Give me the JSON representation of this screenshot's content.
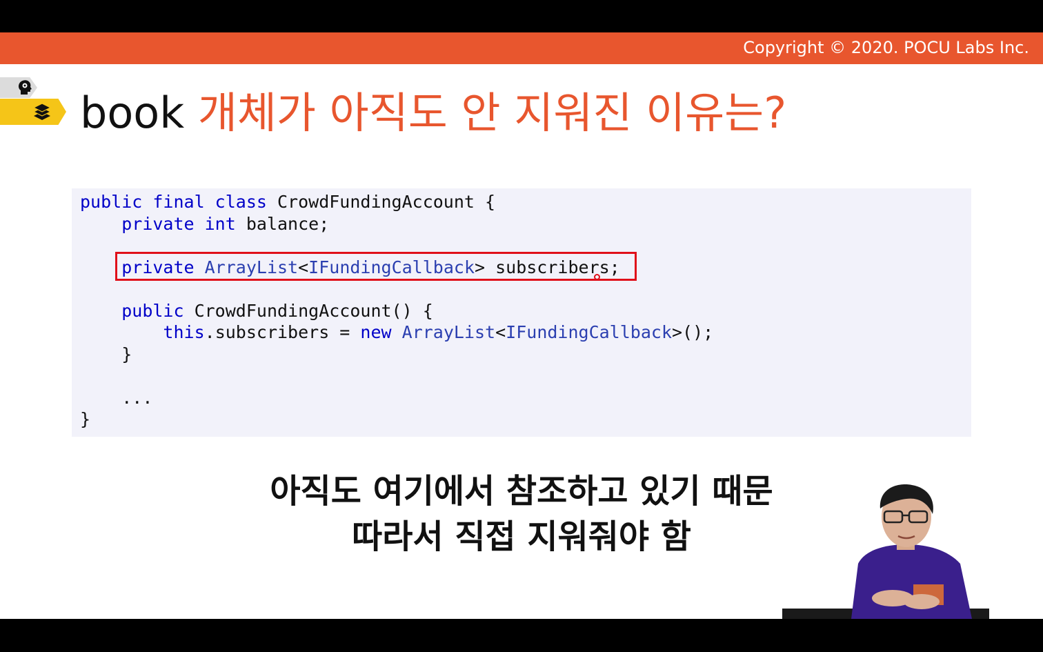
{
  "header": {
    "copyright": "Copyright © 2020. POCU Labs Inc."
  },
  "sidebar_tags": {
    "top_icon": "head-brain-icon",
    "bottom_icon": "stacked-books-icon",
    "colors": {
      "top": "#dcdcdc",
      "bottom": "#f5c518"
    }
  },
  "title": {
    "keyword": "book",
    "text": "개체가 아직도 안 지워진 이유는?"
  },
  "code": {
    "line1": {
      "kw": "public final class",
      "rest": " CrowdFundingAccount {"
    },
    "line2": {
      "kw": "private int",
      "rest": " balance;"
    },
    "line3": {
      "kw": "private",
      "type": "ArrayList",
      "lt": "<",
      "type2": "IFundingCallback",
      "rest": "> subscribers;"
    },
    "line4": {
      "kw": "public",
      "rest": " CrowdFundingAccount() {"
    },
    "line5": {
      "kw": "this",
      "mid": ".subscribers = ",
      "kw2": "new",
      "type": "ArrayList",
      "lt": "<",
      "type2": "IFundingCallback",
      "rest": ">();"
    },
    "line6": "}",
    "line7": "...",
    "line8": "}"
  },
  "subtitles": {
    "line1": "아직도 여기에서 참조하고 있기 때문",
    "line2": "따라서 직접 지워줘야 함"
  },
  "colors": {
    "accent": "#e8562e",
    "keyword": "#0000c8",
    "highlight": "#e0101a",
    "code_bg": "#f2f2fa"
  }
}
